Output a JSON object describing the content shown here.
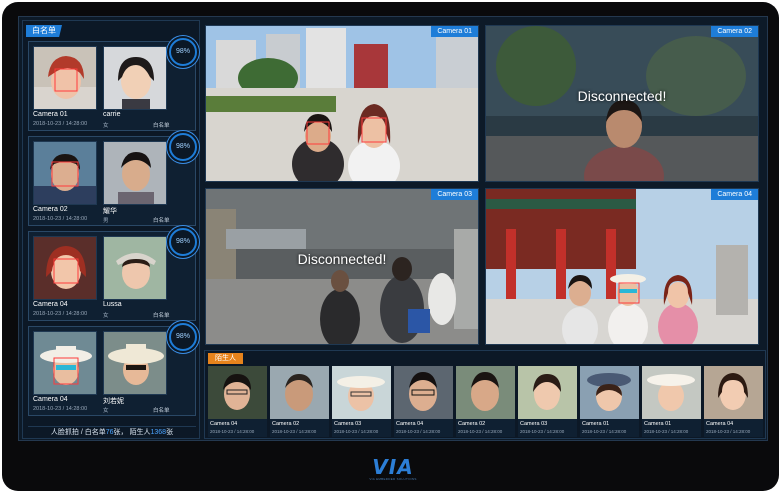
{
  "whitelist": {
    "tab_label": "白名单",
    "matches": [
      {
        "camera": "Camera  01",
        "time": "2018-10-23 / 14:28:00",
        "name": "carrie",
        "gender": "女",
        "list": "白名单",
        "similarity": "98%"
      },
      {
        "camera": "Camera  02",
        "time": "2018-10-23 / 14:28:00",
        "name": "耀华",
        "gender": "男",
        "list": "白名单",
        "similarity": "98%"
      },
      {
        "camera": "Camera  04",
        "time": "2018-10-23 / 14:28:00",
        "name": "Lussa",
        "gender": "女",
        "list": "白名单",
        "similarity": "98%"
      },
      {
        "camera": "Camera  04",
        "time": "2018-10-23 / 14:28:00",
        "name": "刘若妮",
        "gender": "女",
        "list": "白名单",
        "similarity": "98%"
      }
    ],
    "stats": {
      "prefix": "人脸抓拍 / 白名单",
      "whitelist_count": "76",
      "mid": "张，  陌生人",
      "stranger_count": "1368",
      "suffix": "张"
    }
  },
  "cameras": [
    {
      "label": "Camera 01",
      "status": ""
    },
    {
      "label": "Camera 02",
      "status": "Disconnected!"
    },
    {
      "label": "Camera 03",
      "status": "Disconnected!"
    },
    {
      "label": "Camera 04",
      "status": ""
    }
  ],
  "strangers": {
    "tab_label": "陌生人",
    "items": [
      {
        "camera": "Camera 04",
        "time": "2018-10-23 / 14:28:00"
      },
      {
        "camera": "Camera 02",
        "time": "2018-10-23 / 14:28:00"
      },
      {
        "camera": "Camera 03",
        "time": "2018-10-23 / 14:28:00"
      },
      {
        "camera": "Camera 04",
        "time": "2018-10-23 / 14:28:00"
      },
      {
        "camera": "Camera 02",
        "time": "2018-10-23 / 14:28:00"
      },
      {
        "camera": "Camera 03",
        "time": "2018-10-23 / 14:28:00"
      },
      {
        "camera": "Camera 01",
        "time": "2018-10-23 / 14:28:00"
      },
      {
        "camera": "Camera 01",
        "time": "2018-10-23 / 14:28:00"
      },
      {
        "camera": "Camera 04",
        "time": "2018-10-23 / 14:28:00"
      }
    ]
  },
  "brand": {
    "logo": "VIA",
    "tagline": "VIA EMBEDDED SOLUTIONS"
  },
  "colors": {
    "accent": "#1e7dd8",
    "stranger_tag": "#e6831c",
    "bbox": "#ff3b3b",
    "background": "#0d1a28"
  }
}
